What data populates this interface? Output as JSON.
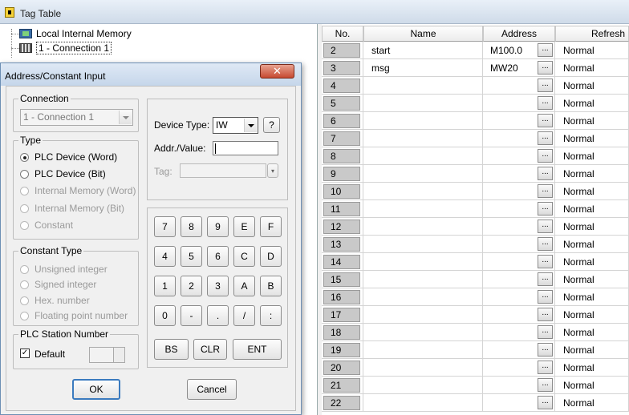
{
  "topbar": {
    "title": "Tag Table"
  },
  "tree": {
    "items": [
      {
        "label": "Local Internal Memory",
        "icon": "memory-icon"
      },
      {
        "label": "1 - Connection 1",
        "icon": "connection-icon"
      }
    ]
  },
  "table": {
    "headers": {
      "no": "No.",
      "name": "Name",
      "address": "Address",
      "refresh": "Refresh"
    },
    "address_button": "...",
    "rows": [
      {
        "no": "2",
        "name": "start",
        "address": "M100.0",
        "refresh": "Normal"
      },
      {
        "no": "3",
        "name": "msg",
        "address": "MW20",
        "refresh": "Normal"
      },
      {
        "no": "4",
        "name": "",
        "address": "",
        "refresh": "Normal"
      },
      {
        "no": "5",
        "name": "",
        "address": "",
        "refresh": "Normal"
      },
      {
        "no": "6",
        "name": "",
        "address": "",
        "refresh": "Normal"
      },
      {
        "no": "7",
        "name": "",
        "address": "",
        "refresh": "Normal"
      },
      {
        "no": "8",
        "name": "",
        "address": "",
        "refresh": "Normal"
      },
      {
        "no": "9",
        "name": "",
        "address": "",
        "refresh": "Normal"
      },
      {
        "no": "10",
        "name": "",
        "address": "",
        "refresh": "Normal"
      },
      {
        "no": "11",
        "name": "",
        "address": "",
        "refresh": "Normal"
      },
      {
        "no": "12",
        "name": "",
        "address": "",
        "refresh": "Normal"
      },
      {
        "no": "13",
        "name": "",
        "address": "",
        "refresh": "Normal"
      },
      {
        "no": "14",
        "name": "",
        "address": "",
        "refresh": "Normal"
      },
      {
        "no": "15",
        "name": "",
        "address": "",
        "refresh": "Normal"
      },
      {
        "no": "16",
        "name": "",
        "address": "",
        "refresh": "Normal"
      },
      {
        "no": "17",
        "name": "",
        "address": "",
        "refresh": "Normal"
      },
      {
        "no": "18",
        "name": "",
        "address": "",
        "refresh": "Normal"
      },
      {
        "no": "19",
        "name": "",
        "address": "",
        "refresh": "Normal"
      },
      {
        "no": "20",
        "name": "",
        "address": "",
        "refresh": "Normal"
      },
      {
        "no": "21",
        "name": "",
        "address": "",
        "refresh": "Normal"
      },
      {
        "no": "22",
        "name": "",
        "address": "",
        "refresh": "Normal"
      }
    ]
  },
  "dialog": {
    "title": "Address/Constant Input",
    "close_glyph": "✕",
    "connection": {
      "legend": "Connection",
      "value": "1 - Connection 1"
    },
    "type": {
      "legend": "Type",
      "options": [
        {
          "label": "PLC Device (Word)",
          "selected": true,
          "enabled": true
        },
        {
          "label": "PLC Device (Bit)",
          "selected": false,
          "enabled": true
        },
        {
          "label": "Internal Memory (Word)",
          "selected": false,
          "enabled": false
        },
        {
          "label": "Internal Memory (Bit)",
          "selected": false,
          "enabled": false
        },
        {
          "label": "Constant",
          "selected": false,
          "enabled": false
        }
      ]
    },
    "constant_type": {
      "legend": "Constant Type",
      "options": [
        {
          "label": "Unsigned integer"
        },
        {
          "label": "Signed integer"
        },
        {
          "label": "Hex. number"
        },
        {
          "label": "Floating point number"
        }
      ]
    },
    "station": {
      "legend": "PLC Station Number",
      "default_label": "Default",
      "default_checked": true,
      "check_glyph": "✓"
    },
    "device": {
      "device_type_label": "Device Type:",
      "device_type_value": "IW",
      "help_label": "?",
      "addr_label": "Addr./Value:",
      "addr_value": "",
      "tag_label": "Tag:"
    },
    "keypad": [
      [
        "7",
        "8",
        "9",
        "E",
        "F"
      ],
      [
        "4",
        "5",
        "6",
        "C",
        "D"
      ],
      [
        "1",
        "2",
        "3",
        "A",
        "B"
      ],
      [
        "0",
        "-",
        ".",
        "/",
        ":"
      ]
    ],
    "keypad_actions": {
      "bs": "BS",
      "clr": "CLR",
      "ent": "ENT"
    },
    "ok_label": "OK",
    "cancel_label": "Cancel"
  }
}
